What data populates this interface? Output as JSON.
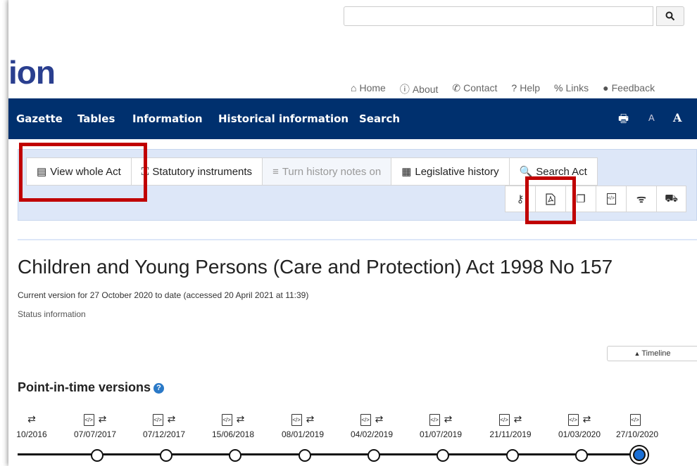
{
  "header": {
    "logo_text": "ion",
    "search_placeholder": "",
    "search_button_icon": "search-icon",
    "links": [
      {
        "icon": "⌂",
        "label": "Home"
      },
      {
        "icon": "ⓘ",
        "label": "About"
      },
      {
        "icon": "✆",
        "label": "Contact"
      },
      {
        "icon": "?",
        "label": "Help"
      },
      {
        "icon": "🔗",
        "label": "Links"
      },
      {
        "icon": "💬",
        "label": "Feedback"
      }
    ]
  },
  "nav": {
    "items": [
      "Gazette",
      "Tables",
      "Information",
      "Historical information",
      "Search"
    ],
    "print_icon": "🖶",
    "font_small": "A",
    "font_large": "A"
  },
  "toolbar": {
    "tabs": [
      {
        "icon": "▤",
        "label": "View whole Act"
      },
      {
        "icon": "⛶",
        "label": "Statutory instruments"
      },
      {
        "icon": "≡",
        "label": "Turn history notes on"
      },
      {
        "icon": "▦",
        "label": "Legislative history"
      },
      {
        "icon": "🔍",
        "label": "Search Act"
      }
    ],
    "icon_buttons": [
      "key-icon",
      "pdf-icon",
      "copy-icon",
      "xml-icon",
      "rss-icon",
      "truck-icon"
    ]
  },
  "document": {
    "title": "Children and Young Persons (Care and Protection) Act 1998 No 157",
    "version_text": "Current version for 27 October 2020 to date (accessed 20 April 2021 at 11:39)",
    "status_text": "Status information",
    "timeline_button": "Timeline"
  },
  "pit": {
    "title": "Point-in-time versions",
    "help": "?",
    "versions": [
      {
        "date": "10/2016"
      },
      {
        "date": "07/07/2017"
      },
      {
        "date": "07/12/2017"
      },
      {
        "date": "15/06/2018"
      },
      {
        "date": "08/01/2019"
      },
      {
        "date": "04/02/2019"
      },
      {
        "date": "01/07/2019"
      },
      {
        "date": "21/11/2019"
      },
      {
        "date": "01/03/2020"
      },
      {
        "date": "27/10/2020"
      }
    ]
  }
}
